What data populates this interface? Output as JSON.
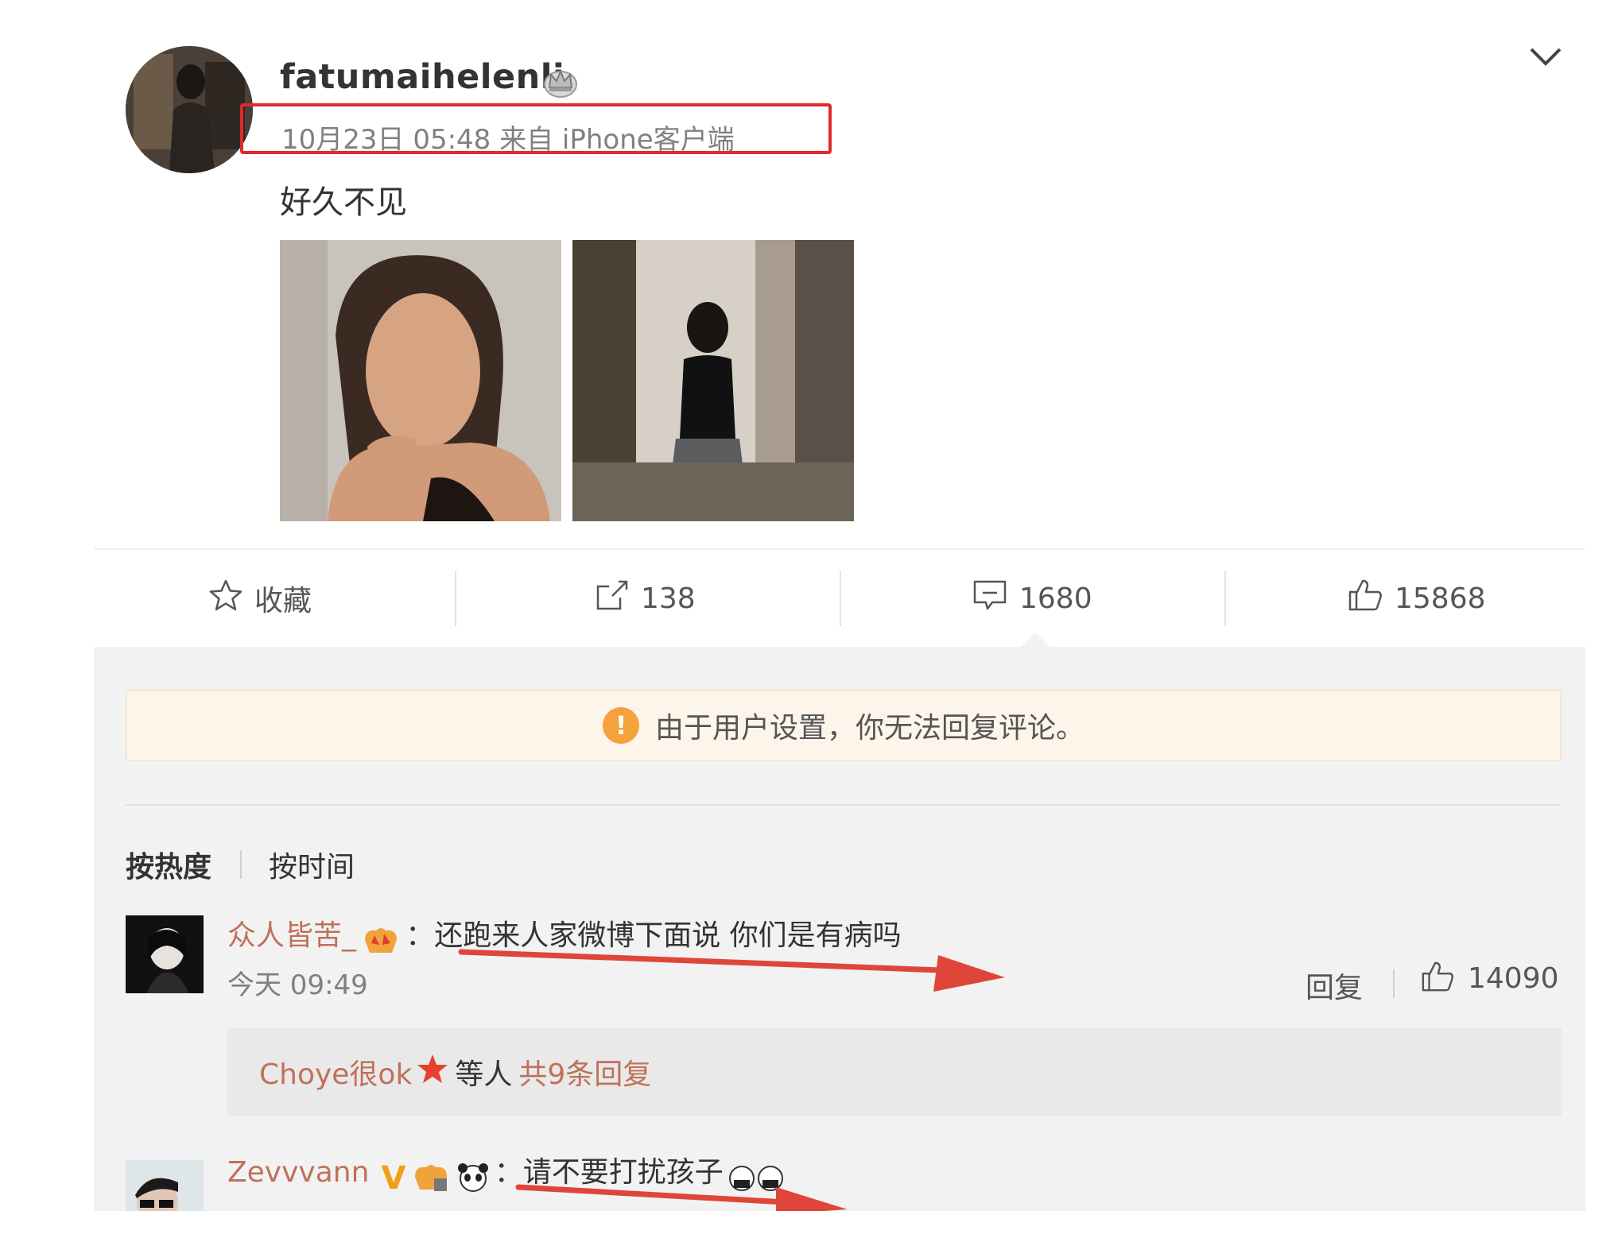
{
  "post": {
    "username": "fatumaihelenli",
    "meta": "10月23日 05:48 来自 iPhone客户端",
    "text": "好久不见",
    "highlight_color": "#e02a2a"
  },
  "actions": {
    "favorite_label": "收藏",
    "repost_count": "138",
    "comment_count": "1680",
    "like_count": "15868"
  },
  "notice": {
    "icon": "!",
    "text": "由于用户设置，你无法回复评论。"
  },
  "sort": {
    "hot_label": "按热度",
    "time_label": "按时间"
  },
  "comments": [
    {
      "name": "众人皆苦_",
      "text": "：还跑来人家微博下面说 你们是有病吗",
      "time": "今天 09:49",
      "reply_label": "回复",
      "likes": "14090",
      "replies": {
        "names": "Choye很ok",
        "mid": "等人",
        "count": "共9条回复"
      }
    },
    {
      "name": "Zevvvann",
      "verified": "V",
      "text": "：请不要打扰孩子"
    }
  ],
  "colors": {
    "accent_name": "#c0715a",
    "annotation_red": "#e02a2a",
    "notice_bg": "#fdf5ea",
    "notice_icon": "#f5a13c"
  }
}
